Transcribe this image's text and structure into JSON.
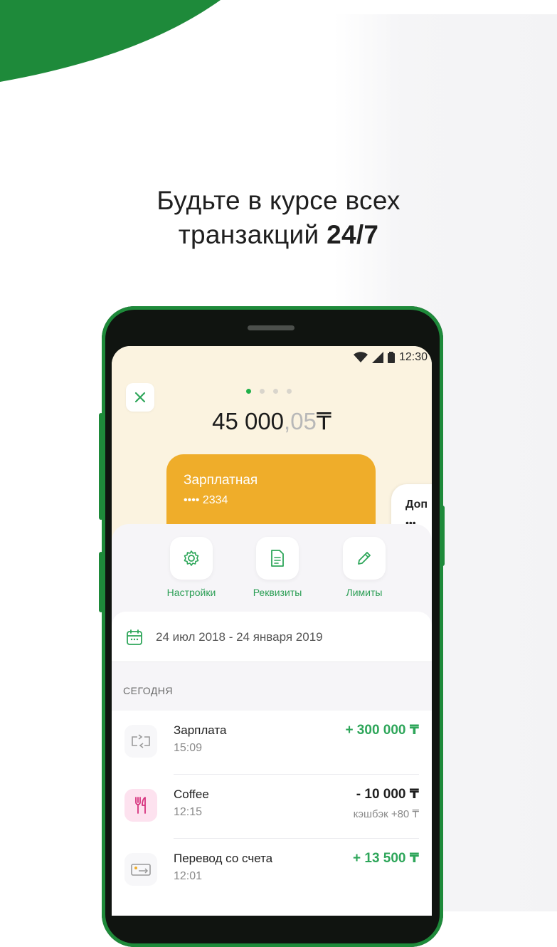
{
  "headline": {
    "line1": "Будьте в курсе всех",
    "line2_prefix": "транзакций ",
    "line2_bold": "24/7"
  },
  "status_bar": {
    "time": "12:30"
  },
  "balance": {
    "whole": "45 000",
    "fraction": ",05",
    "currency": "₸"
  },
  "pager": {
    "total": 4,
    "active": 0
  },
  "cards": [
    {
      "name": "Зарплатная",
      "number": "•••• 2334"
    },
    {
      "name": "Доп",
      "number": "•••"
    }
  ],
  "actions": [
    {
      "label": "Настройки",
      "icon": "gear-icon"
    },
    {
      "label": "Реквизиты",
      "icon": "document-icon"
    },
    {
      "label": "Лимиты",
      "icon": "pencil-icon"
    }
  ],
  "date_range": "24 июл 2018 - 24 января 2019",
  "section_label": "СЕГОДНЯ",
  "transactions": [
    {
      "title": "Зарплата",
      "time": "15:09",
      "amount": "+ 300 000 ₸",
      "sign": "pos",
      "icon": "transfer-icon",
      "sub": ""
    },
    {
      "title": "Coffee",
      "time": "12:15",
      "amount": "- 10 000 ₸",
      "sign": "neg",
      "icon": "fork-knife-icon",
      "sub": "кэшбэк +80 ₸"
    },
    {
      "title": "Перевод со счета",
      "time": "12:01",
      "amount": "+ 13 500 ₸",
      "sign": "pos",
      "icon": "card-transfer-icon",
      "sub": ""
    }
  ],
  "colors": {
    "brand_green": "#1e8a3a",
    "accent_green": "#2ea65a",
    "card_orange": "#efad2a",
    "top_bg": "#fbf3e0"
  }
}
